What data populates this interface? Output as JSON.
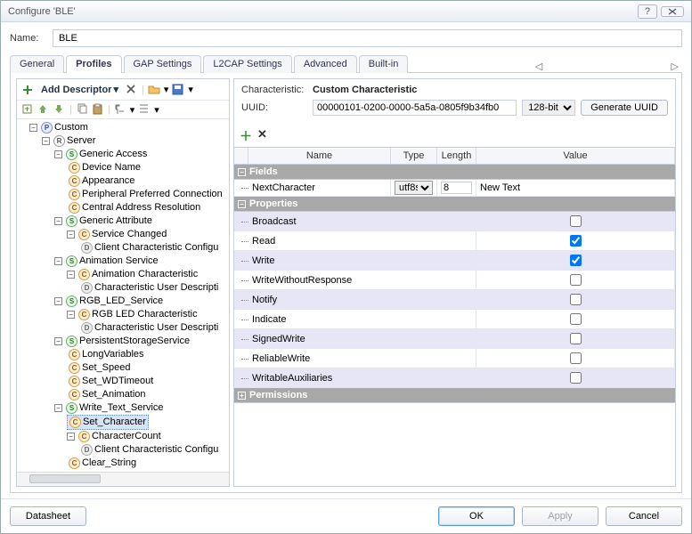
{
  "window": {
    "title": "Configure 'BLE'"
  },
  "nameField": {
    "label": "Name:",
    "value": "BLE"
  },
  "tabs": [
    "General",
    "Profiles",
    "GAP Settings",
    "L2CAP Settings",
    "Advanced",
    "Built-in"
  ],
  "activeTab": "Profiles",
  "toolbar": {
    "addDescriptor": "Add Descriptor"
  },
  "tree": {
    "root": "Custom",
    "server": "Server",
    "genericAccess": "Generic Access",
    "deviceName": "Device Name",
    "appearance": "Appearance",
    "periphPref": "Peripheral Preferred Connection",
    "centralAddr": "Central Address Resolution",
    "genericAttr": "Generic Attribute",
    "serviceChanged": "Service Changed",
    "cccd1": "Client Characteristic Configu",
    "animService": "Animation Service",
    "animChar": "Animation Characteristic",
    "cud1": "Characteristic User Descripti",
    "rgbService": "RGB_LED_Service",
    "rgbChar": "RGB LED Characteristic",
    "cud2": "Characteristic User Descripti",
    "persistService": "PersistentStorageService",
    "longVars": "LongVariables",
    "setSpeed": "Set_Speed",
    "setWD": "Set_WDTimeout",
    "setAnim": "Set_Animation",
    "writeTextSvc": "Write_Text_Service",
    "setChar": "Set_Character",
    "charCount": "CharacterCount",
    "cccd2": "Client Characteristic Configu",
    "clearString": "Clear_String"
  },
  "char": {
    "label": "Characteristic:",
    "name": "Custom Characteristic",
    "uuidLabel": "UUID:",
    "uuid": "00000101-0200-0000-5a5a-0805f9b34fb0",
    "bits": "128-bit",
    "genBtn": "Generate UUID"
  },
  "gridHeaders": {
    "name": "Name",
    "type": "Type",
    "length": "Length",
    "value": "Value"
  },
  "sections": {
    "fields": "Fields",
    "properties": "Properties",
    "permissions": "Permissions"
  },
  "field": {
    "name": "NextCharacter",
    "type": "utf8s",
    "length": "8",
    "value": "New Text"
  },
  "props": [
    {
      "name": "Broadcast",
      "checked": false
    },
    {
      "name": "Read",
      "checked": true
    },
    {
      "name": "Write",
      "checked": true
    },
    {
      "name": "WriteWithoutResponse",
      "checked": false
    },
    {
      "name": "Notify",
      "checked": false
    },
    {
      "name": "Indicate",
      "checked": false
    },
    {
      "name": "SignedWrite",
      "checked": false
    },
    {
      "name": "ReliableWrite",
      "checked": false
    },
    {
      "name": "WritableAuxiliaries",
      "checked": false
    }
  ],
  "footer": {
    "datasheet": "Datasheet",
    "ok": "OK",
    "apply": "Apply",
    "cancel": "Cancel"
  }
}
